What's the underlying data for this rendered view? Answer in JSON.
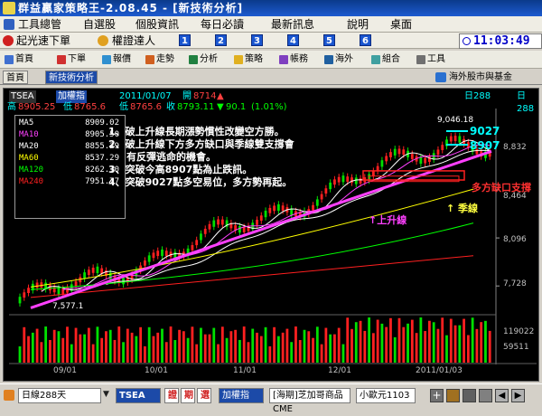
{
  "window": {
    "title": "群益贏家策略王-2.08.45 - [新技術分析]"
  },
  "menu": {
    "items": [
      "工具總管",
      "自選股",
      "個股資訊",
      "每日必讀",
      "最新訊息",
      "說明",
      "桌面"
    ]
  },
  "quickbar": {
    "left1": "起光速下單",
    "left2": "權證達人",
    "numbers": [
      "1",
      "2",
      "3",
      "4",
      "5",
      "6"
    ],
    "clock": "11:03:49"
  },
  "toolbar": {
    "items": [
      "首頁",
      "下單",
      "報價",
      "走勢",
      "分析",
      "策略",
      "帳務",
      "海外",
      "組合",
      "工具"
    ]
  },
  "tabs": {
    "items": [
      "首頁",
      "新技術分析"
    ],
    "right": "海外股市與基金"
  },
  "chart_header": {
    "symbol": "TSEA",
    "name": "加權指",
    "date": "2011/01/07",
    "open_label": "開",
    "open": "8714",
    "open_arrow": "▲",
    "high_label": "高",
    "high": "8905.25",
    "low_label": "低",
    "low": "8765.6",
    "close_label": "收",
    "close": "8793.11",
    "change_arrow": "▼",
    "change": "90.1",
    "pct": "(1.01%)",
    "period": "日288"
  },
  "legend": [
    {
      "name": "MA5",
      "value": "8909.02",
      "color": "#ffffff"
    },
    {
      "name": "MA10",
      "value": "8905.50",
      "color": "#ff40ff"
    },
    {
      "name": "MA20",
      "value": "8855.29",
      "color": "#ffffff"
    },
    {
      "name": "MA60",
      "value": "8537.29",
      "color": "#ffff00"
    },
    {
      "name": "MA120",
      "value": "8262.10",
      "color": "#00ff00"
    },
    {
      "name": "MA240",
      "value": "7951.77",
      "color": "#ff2020"
    }
  ],
  "annotations": [
    {
      "num": "1",
      "text": "、破上升線長期漲勢慣性改變空方勝。"
    },
    {
      "num": "2",
      "text": "、破上升線下方多方缺口與季線雙支撐會"
    },
    {
      "num": "",
      "text": "有反彈逃命的機會。"
    },
    {
      "num": "3",
      "text": "、突破今高8907點為止跌訊。"
    },
    {
      "num": "4",
      "text": "、突破9027點多空易位，多方勢再起。"
    }
  ],
  "chart_labels": {
    "level1": "9027",
    "level2": "8907",
    "peak": "9,046.18",
    "low_point": "7,577.1",
    "gap_support": "多方缺口支撐",
    "season_line": "↑ 季線",
    "uptrend": "↑上升線"
  },
  "chart_data": {
    "type": "candlestick",
    "y_ticks": [
      "8,832",
      "8,464",
      "8,096",
      "7,728"
    ],
    "vol_ticks": [
      "119022",
      "59511"
    ],
    "x_ticks": [
      "09/01",
      "10/01",
      "11/01",
      "12/01",
      "2011/01/03"
    ],
    "ylim": [
      7577,
      9046
    ]
  },
  "statusbar": {
    "range": "日線288天",
    "symbol": "TSEA",
    "btn_news": "證",
    "btn_chart": "期",
    "btn_sell": "選",
    "name": "加權指",
    "futures": "[海期]芝加哥商品CME",
    "contract": "小歐元1103"
  },
  "colors": {
    "up": "#ff2020",
    "down": "#00e000",
    "trend_line": "#ff40ff"
  }
}
